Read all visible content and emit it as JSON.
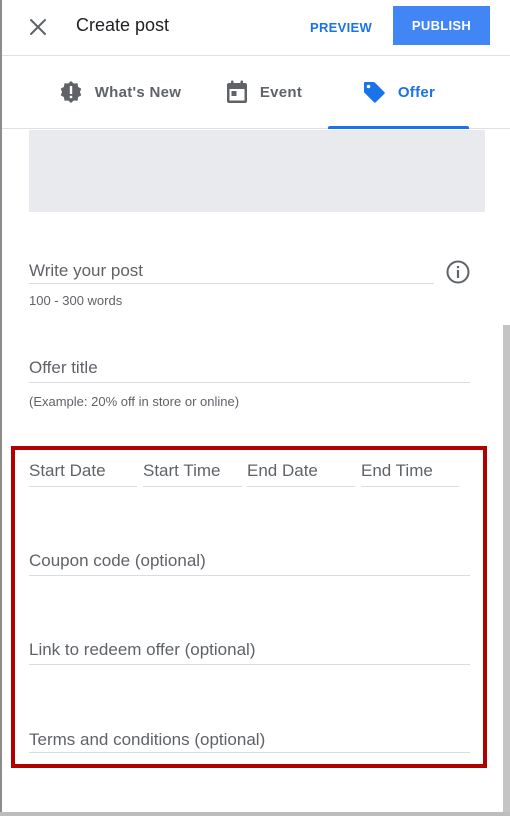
{
  "header": {
    "title": "Create post",
    "preview_label": "PREVIEW",
    "publish_label": "PUBLISH"
  },
  "tabs": [
    {
      "label": "What's New",
      "icon": "alert-badge-icon",
      "active": false
    },
    {
      "label": "Event",
      "icon": "calendar-icon",
      "active": false
    },
    {
      "label": "Offer",
      "icon": "tag-icon",
      "active": true
    }
  ],
  "form": {
    "post": {
      "placeholder": "Write your post",
      "helper": "100 - 300 words"
    },
    "offer_title": {
      "placeholder": "Offer title",
      "helper": "(Example: 20% off in store or online)"
    },
    "start_date": {
      "placeholder": "Start Date"
    },
    "start_time": {
      "placeholder": "Start Time"
    },
    "end_date": {
      "placeholder": "End Date"
    },
    "end_time": {
      "placeholder": "End Time"
    },
    "coupon_code": {
      "placeholder": "Coupon code (optional)"
    },
    "redeem_link": {
      "placeholder": "Link to redeem offer (optional)"
    },
    "terms": {
      "placeholder": "Terms and conditions (optional)"
    }
  },
  "colors": {
    "accent": "#1a73e8",
    "publish_bg": "#4285f4",
    "highlight": "#b00000",
    "image_placeholder": "#e8eaed"
  }
}
